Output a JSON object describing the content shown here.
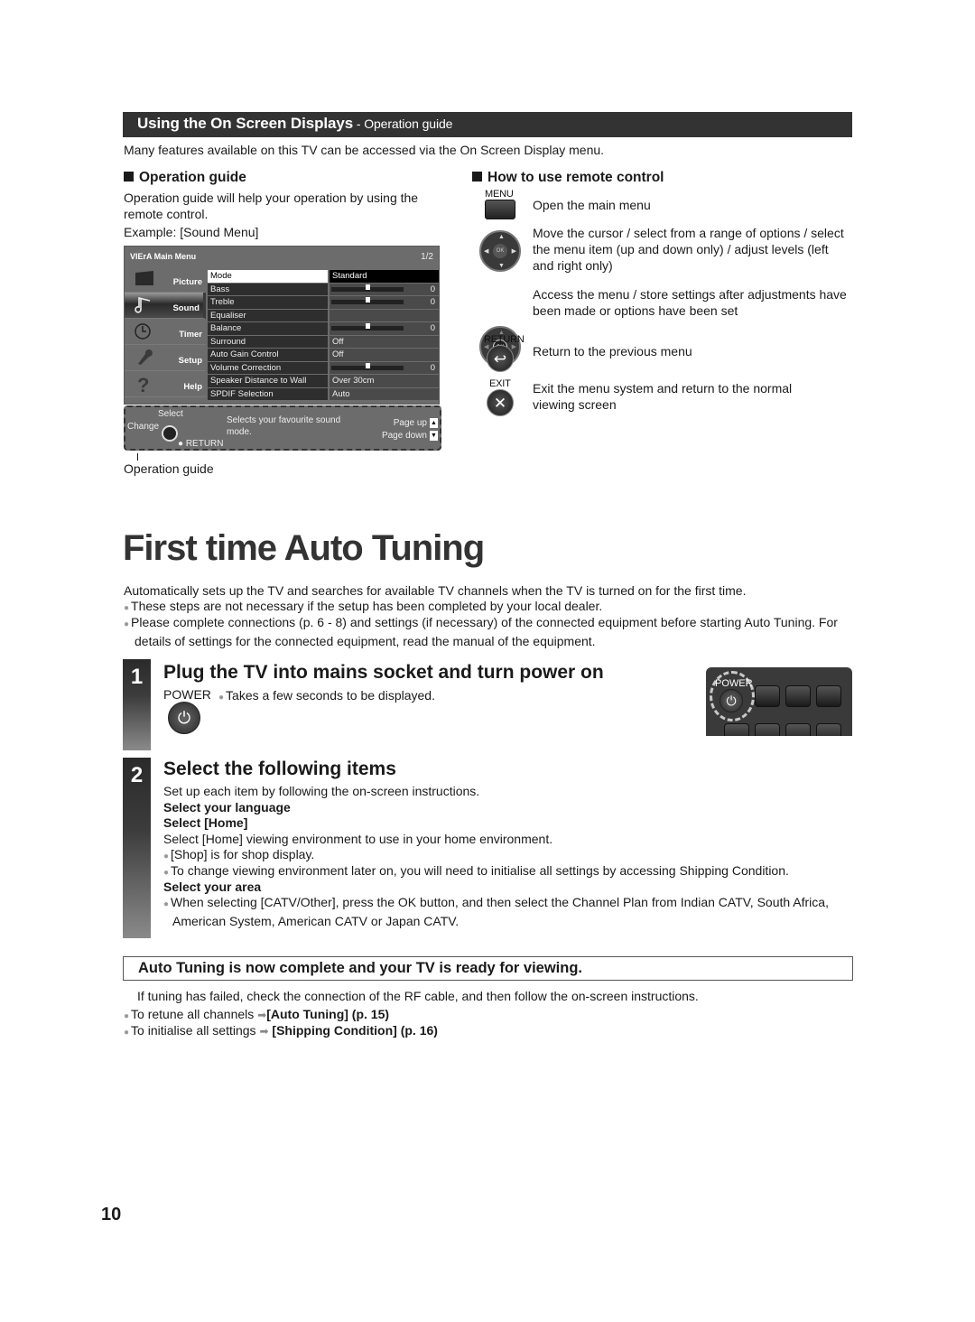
{
  "osd_section": {
    "title": "Using the On Screen Displays",
    "subtitle": " - Operation guide",
    "intro": "Many features available on this TV can be accessed via the On Screen Display menu.",
    "operation_guide": {
      "heading": "Operation guide",
      "text": "Operation guide will help your operation by using the remote control.",
      "example": "Example: [Sound Menu]",
      "caption": "Operation guide"
    },
    "tv_menu": {
      "title": "VIErA Main Menu",
      "page": "1/2",
      "categories": [
        {
          "label": "Picture",
          "icon": "tv-icon"
        },
        {
          "label": "Sound",
          "icon": "music-note-icon",
          "active": true
        },
        {
          "label": "Timer",
          "icon": "clock-icon"
        },
        {
          "label": "Setup",
          "icon": "wrench-icon"
        },
        {
          "label": "Help",
          "icon": "question-icon"
        }
      ],
      "rows": [
        {
          "name": "Mode",
          "value": "Standard",
          "selected": true
        },
        {
          "name": "Bass",
          "slider": 0.5,
          "value": "0"
        },
        {
          "name": "Treble",
          "slider": 0.5,
          "value": "0"
        },
        {
          "name": "Equaliser",
          "value": ""
        },
        {
          "name": "Balance",
          "slider": 0.5,
          "value": "0"
        },
        {
          "name": "Surround",
          "value": "Off"
        },
        {
          "name": "Auto Gain Control",
          "value": "Off"
        },
        {
          "name": "Volume Correction",
          "slider": 0.5,
          "value": "0"
        },
        {
          "name": "Speaker Distance to Wall",
          "value": "Over 30cm"
        },
        {
          "name": "SPDIF Selection",
          "value": "Auto"
        }
      ],
      "guide": {
        "select": "Select",
        "change": "Change",
        "return": "RETURN",
        "description": "Selects your favourite sound mode.",
        "page_up": "Page up",
        "page_down": "Page down"
      }
    },
    "remote_control": {
      "heading": "How to use remote control",
      "items": [
        {
          "key_label": "MENU",
          "icon": "menu-button-icon",
          "text": "Open the main menu"
        },
        {
          "key_label": "",
          "icon": "cursor-dpad-icon",
          "text": "Move the cursor / select from a range of options / select the menu item (up and down only) / adjust levels (left and right only)"
        },
        {
          "key_label": "",
          "icon": "ok-button-icon",
          "text": "Access the menu / store settings after adjustments have been made or options have been set"
        },
        {
          "key_label": "RETURN",
          "icon": "return-button-icon",
          "text": "Return to the previous menu"
        },
        {
          "key_label": "EXIT",
          "icon": "exit-button-icon",
          "text": "Exit the menu system and return to the normal viewing screen"
        }
      ]
    }
  },
  "auto_tuning": {
    "title": "First time Auto Tuning",
    "intro": "Automatically sets up the TV and searches for available TV channels when the TV is turned on for the first time.",
    "bullets": [
      "These steps are not necessary if the setup has been completed by your local dealer.",
      "Please complete connections (p. 6 - 8) and settings (if necessary) of the connected equipment before starting Auto Tuning. For details of settings for the connected equipment, read the manual of the equipment."
    ],
    "step1": {
      "number": "1",
      "heading": "Plug the TV into mains socket and turn power on",
      "power_label": "POWER",
      "note": "Takes a few seconds to be displayed.",
      "remote_power_label": "POWER"
    },
    "step2": {
      "number": "2",
      "heading": "Select the following items",
      "intro": "Set up each item by following the on-screen instructions.",
      "select_language": "Select your language",
      "select_home": "Select [Home]",
      "home_text": "Select [Home] viewing environment to use in your home environment.",
      "home_bullets": [
        "[Shop] is for shop display.",
        "To change viewing environment later on, you will need to initialise all settings by accessing Shipping Condition."
      ],
      "select_area": "Select your area",
      "area_bullet": "When selecting [CATV/Other], press the OK button, and then select the Channel Plan from Indian CATV, South Africa, American System, American CATV or Japan CATV."
    },
    "complete": {
      "banner": "Auto Tuning is now complete and your TV is ready for viewing.",
      "failed_text": "If tuning has failed, check the connection of the RF cable, and then follow the on-screen instructions.",
      "links": [
        {
          "prefix": "To retune all channels",
          "target": "[Auto Tuning] (p. 15)"
        },
        {
          "prefix": "To initialise all settings",
          "target": "[Shipping Condition] (p. 16)"
        }
      ]
    }
  },
  "page_number": "10"
}
